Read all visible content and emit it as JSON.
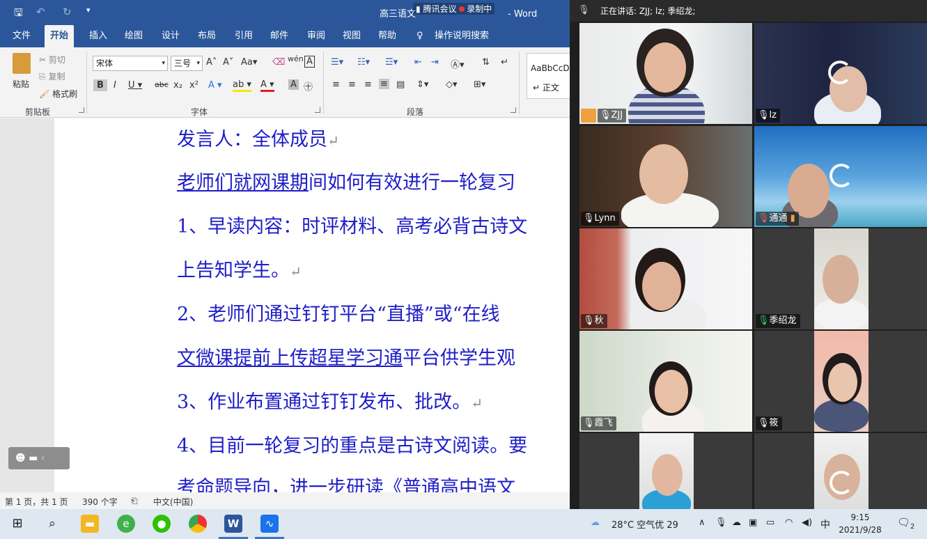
{
  "word": {
    "doc_title": "高三语文",
    "app_name": "Word",
    "title_suffix": "- Word",
    "meeting_banner": {
      "app": "腾讯会议",
      "recording": "录制中"
    },
    "tabs": [
      "文件",
      "开始",
      "插入",
      "绘图",
      "设计",
      "布局",
      "引用",
      "邮件",
      "审阅",
      "视图",
      "帮助",
      "操作说明搜索"
    ],
    "active_tab": "开始",
    "clipboard": {
      "paste": "粘贴",
      "cut": "剪切",
      "copy": "复制",
      "format_painter": "格式刷",
      "group": "剪贴板"
    },
    "font": {
      "name": "宋体",
      "size": "三号",
      "group": "字体"
    },
    "paragraph": {
      "group": "段落"
    },
    "styles": {
      "preview": "AaBbCcD",
      "normal": "↵ 正文"
    },
    "lines": [
      {
        "pre": "发言人：全体成员",
        "u": "",
        "post": "",
        "mark": "↵"
      },
      {
        "pre": "",
        "u": "老师们就网课期",
        "post": "间如何有效进行一轮复习"
      },
      {
        "pre": "1、早读内容：时评材料、高考必背古诗文",
        "u": "",
        "post": ""
      },
      {
        "pre": "上告知学生。",
        "u": "",
        "post": "",
        "mark": "↵"
      },
      {
        "pre": "2、老师们通过钉钉平台“直播”或“在线",
        "u": "",
        "post": ""
      },
      {
        "pre": "",
        "u": "文微课提前上传超星学习通",
        "post": "平台供学生观"
      },
      {
        "pre": "3、作业布置通过钉钉发布、批改。",
        "u": "",
        "post": "",
        "mark": "↵"
      },
      {
        "pre": "4、目前一轮复习的重点是古诗文阅读。要",
        "u": "",
        "post": ""
      },
      {
        "pre": "考命题导向，进一步研读《普通高中语文",
        "u": "",
        "post": ""
      }
    ],
    "status": {
      "page": "第 1 页，共 1 页",
      "words": "390 个字",
      "language": "中文(中国)"
    }
  },
  "meeting": {
    "speaking": "正在讲话: ZJJ; lz; 季绍龙;",
    "participants": [
      {
        "name": "ZJJ"
      },
      {
        "name": "lz"
      },
      {
        "name": "Lynn"
      },
      {
        "name": "通通"
      },
      {
        "name": "秋"
      },
      {
        "name": "季绍龙"
      },
      {
        "name": "霞飞"
      },
      {
        "name": "筱"
      },
      {
        "name": ""
      },
      {
        "name": ""
      }
    ]
  },
  "taskbar": {
    "weather": "28°C 空气优 29",
    "ime": "中",
    "time": "9:15",
    "date": "2021/9/28",
    "notifications": "2"
  }
}
